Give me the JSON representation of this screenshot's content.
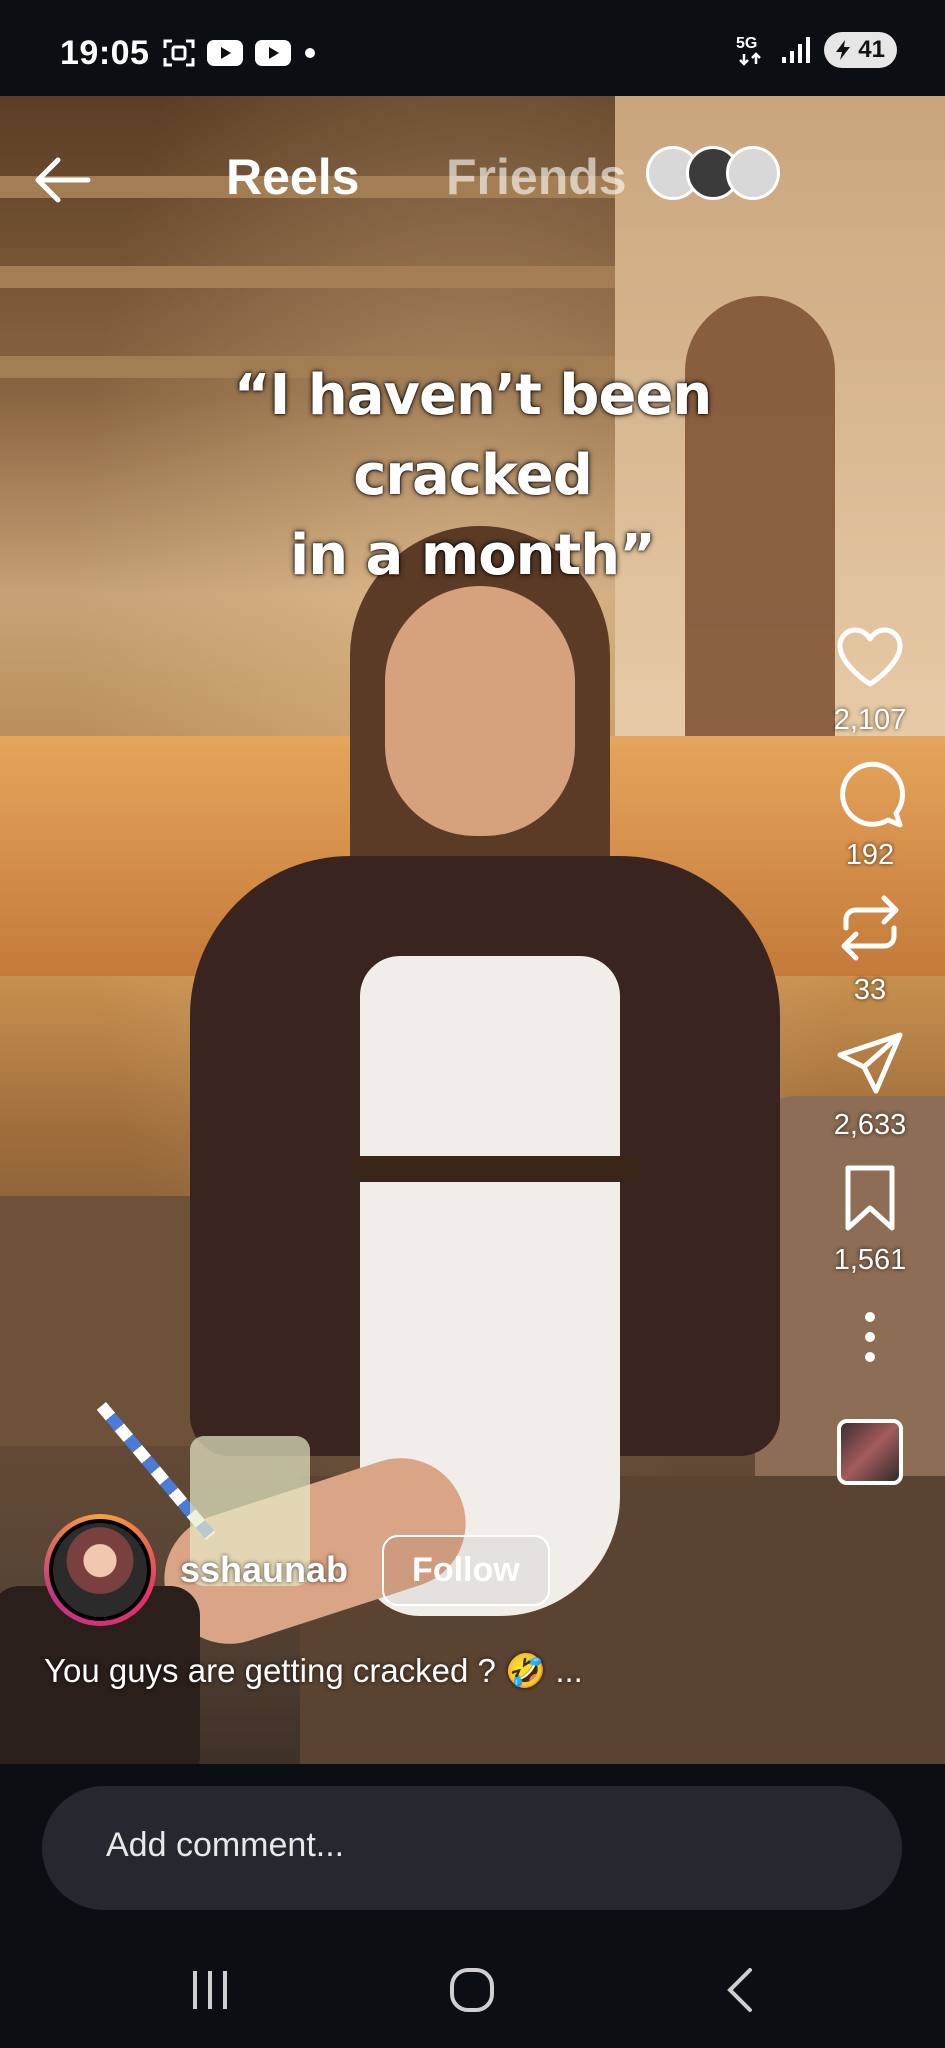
{
  "status_bar": {
    "time": "19:05",
    "network": "5G",
    "battery": "41"
  },
  "top_nav": {
    "tab_reels": "Reels",
    "tab_friends": "Friends"
  },
  "overlay": {
    "line1": "“I haven’t been cracked",
    "line2": "in a month”"
  },
  "actions": {
    "likes": "2,107",
    "comments": "192",
    "reposts": "33",
    "shares": "2,633",
    "saves": "1,561"
  },
  "author": {
    "username": "sshaunab",
    "follow_label": "Follow"
  },
  "post": {
    "caption": "You guys are getting cracked ? 🤣 ..."
  },
  "comment": {
    "placeholder": "Add comment..."
  }
}
